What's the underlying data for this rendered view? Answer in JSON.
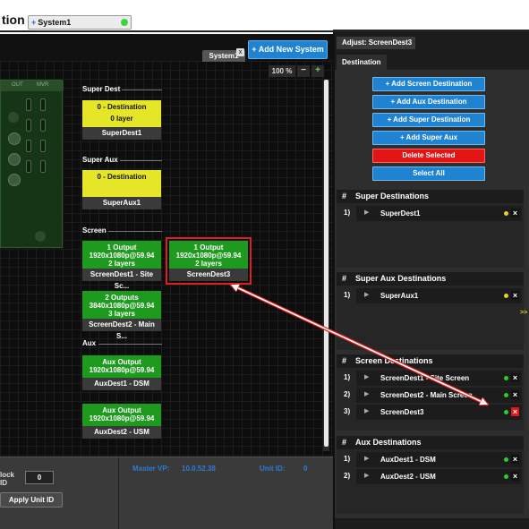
{
  "app": {
    "title_fragment": "tion"
  },
  "titlebar": {
    "system_tab": "System1",
    "system_tab_icon": "plus-icon",
    "status_color": "#3fd43f"
  },
  "canvas": {
    "tab_label": "System1",
    "tab_close": "x",
    "add_system_label": "+ Add New System",
    "zoom_level": "100 %",
    "zoom_out": "−",
    "zoom_in": "+",
    "device": {
      "col1": "OUT",
      "col2": "MVR"
    },
    "sections": {
      "super_dest": "Super Dest",
      "super_aux": "Super Aux",
      "screen": "Screen",
      "aux": "Aux"
    },
    "super_dest_cards": [
      {
        "line1": "0 - Destination",
        "line2": "0 layer",
        "footer": "SuperDest1"
      }
    ],
    "super_aux_cards": [
      {
        "line1": "0 - Destination",
        "footer": "SuperAux1"
      }
    ],
    "screen_cards": [
      {
        "line1": "1 Output",
        "line2": "1920x1080p@59.94",
        "line3": "2 layers",
        "footer": "ScreenDest1 - Site Sc..."
      },
      {
        "line1": "1 Output",
        "line2": "1920x1080p@59.94",
        "line3": "2 layers",
        "footer": "ScreenDest3",
        "selected": true
      },
      {
        "line1": "2 Outputs",
        "line2": "3840x1080p@59.94",
        "line3": "3 layers",
        "footer": "ScreenDest2 - Main S..."
      }
    ],
    "aux_cards": [
      {
        "line1": "Aux Output",
        "line2": "1920x1080p@59.94",
        "footer": "AuxDest1 - DSM"
      },
      {
        "line1": "Aux Output",
        "line2": "1920x1080p@59.94",
        "footer": "AuxDest2 - USM"
      }
    ]
  },
  "bottom": {
    "label_lock": "lock",
    "label_id": "ID",
    "unit_id_value": "0",
    "apply_button": "Apply Unit ID",
    "master_vp_label": "Master VP:",
    "master_vp_value": "10.0.52.38",
    "unit_id_label": "Unit ID:",
    "unit_id_display": "0"
  },
  "right_panel": {
    "adjust_tab": "Adjust: ScreenDest3",
    "destination_tab": "Destination",
    "buttons": {
      "add_screen": "+ Add Screen Destination",
      "add_aux": "+ Add Aux Destination",
      "add_super": "+ Add Super Destination",
      "add_super_aux": "+ Add Super Aux",
      "delete_selected": "Delete Selected",
      "select_all": "Select All"
    },
    "collapse_arrow": ">>",
    "sections": [
      {
        "header": "Super Destinations",
        "rows": [
          {
            "num": "1)",
            "name": "SuperDest1",
            "status": "yellow",
            "delete": "dark"
          }
        ]
      },
      {
        "header": "Super Aux Destinations",
        "rows": [
          {
            "num": "1)",
            "name": "SuperAux1",
            "status": "yellow",
            "delete": "dark"
          }
        ]
      },
      {
        "header": "Screen Destinations",
        "rows": [
          {
            "num": "1)",
            "name": "ScreenDest1 - Site Screen",
            "status": "green",
            "delete": "dark"
          },
          {
            "num": "2)",
            "name": "ScreenDest2 - Main Screen",
            "status": "green",
            "delete": "dark"
          },
          {
            "num": "3)",
            "name": "ScreenDest3",
            "status": "green",
            "delete": "red"
          }
        ]
      },
      {
        "header": "Aux Destinations",
        "rows": [
          {
            "num": "1)",
            "name": "AuxDest1 - DSM",
            "status": "green",
            "delete": "dark"
          },
          {
            "num": "2)",
            "name": "AuxDest2 - USM",
            "status": "green",
            "delete": "dark"
          }
        ]
      }
    ]
  },
  "colors": {
    "accent_blue": "#1f83d2",
    "danger_red": "#e31414",
    "card_green": "#1e9a1e",
    "card_yellow": "#e6e628",
    "annotation_red": "#e02020"
  }
}
